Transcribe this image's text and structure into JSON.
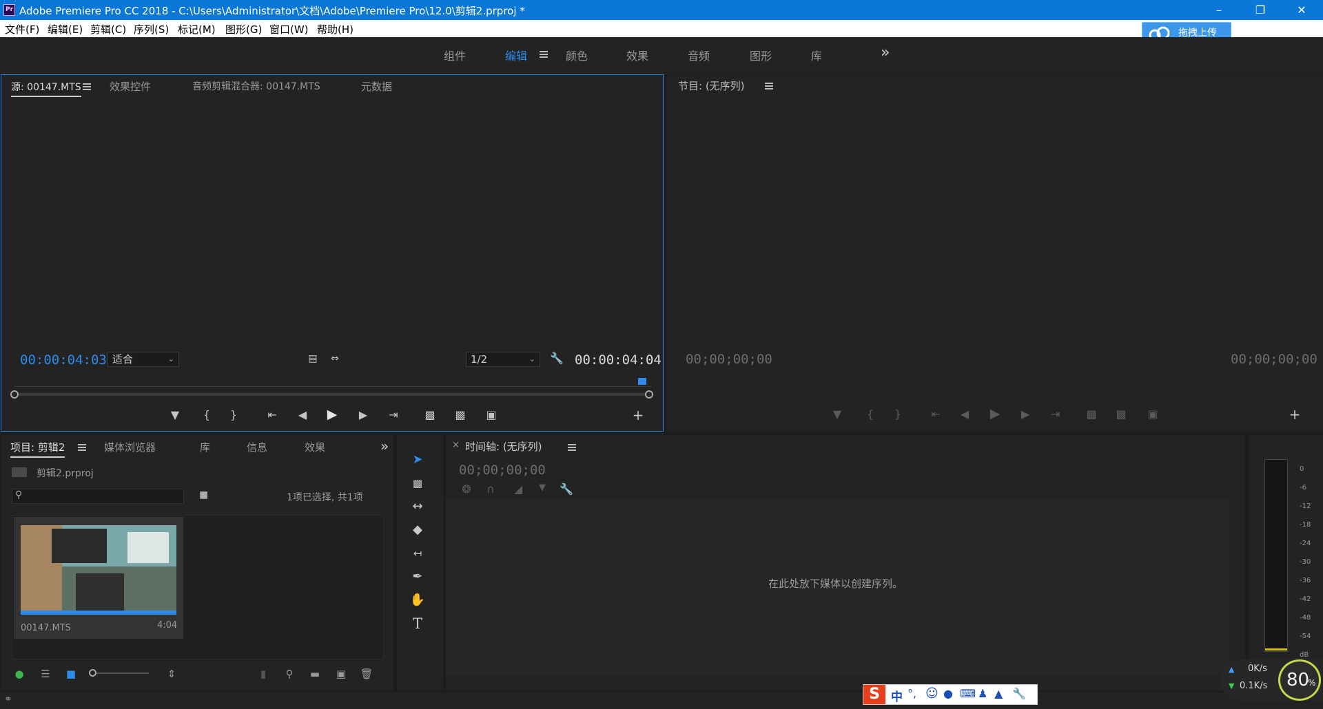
{
  "window": {
    "title": "Adobe Premiere Pro CC 2018 - C:\\Users\\Administrator\\文档\\Adobe\\Premiere Pro\\12.0\\剪辑2.prproj *",
    "logo": "Pr"
  },
  "menu": [
    "文件(F)",
    "编辑(E)",
    "剪辑(C)",
    "序列(S)",
    "标记(M)",
    "图形(G)",
    "窗口(W)",
    "帮助(H)"
  ],
  "upload_button": "拖拽上传",
  "workspaces": [
    "组件",
    "编辑",
    "颜色",
    "效果",
    "音频",
    "图形",
    "库"
  ],
  "workspace_overflow": "»",
  "source": {
    "tabs": [
      "源: 00147.MTS",
      "效果控件",
      "音频剪辑混合器: 00147.MTS",
      "元数据"
    ],
    "timecode_current": "00:00:04:03",
    "fit_select": "适合",
    "resolution_select": "1/2",
    "timecode_duration": "00:00:04:04"
  },
  "program": {
    "tab": "节目: (无序列)",
    "timecode_left": "00;00;00;00",
    "timecode_right": "00;00;00;00"
  },
  "project": {
    "tabs": [
      "项目: 剪辑2",
      "媒体浏览器",
      "库",
      "信息",
      "效果"
    ],
    "file": "剪辑2.prproj",
    "selection_info": "1项已选择, 共1项",
    "clip": {
      "name": "00147.MTS",
      "duration": "4:04"
    }
  },
  "timeline": {
    "close": "×",
    "tab": "时间轴: (无序列)",
    "timecode": "00;00;00;00",
    "drop_hint": "在此处放下媒体以创建序列。"
  },
  "meter": {
    "labels": [
      "0",
      "-6",
      "-12",
      "-18",
      "-24",
      "-30",
      "-36",
      "-42",
      "-48",
      "-54",
      "dB"
    ]
  },
  "net_widget": {
    "up": "0K/s",
    "down": "0.1K/s",
    "percent": "80",
    "percent_unit": "%"
  },
  "ime": {
    "label": "中"
  },
  "colors": {
    "accent": "#2d8ceb",
    "titlebar": "#0b78d7"
  }
}
